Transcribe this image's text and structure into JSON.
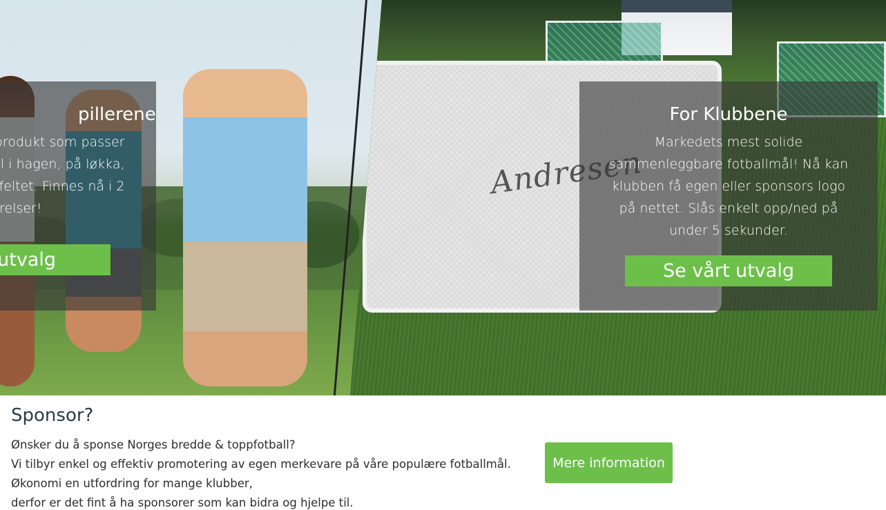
{
  "hero": {
    "left_panel": {
      "heading": "pillerene",
      "text": "produkt som passer pill i hagen, på løkka, feltet. Finnes nå i 2 relser!",
      "lines": [
        "produkt som passer",
        "pill i hagen, på løkka,",
        "feltet. Finnes nå i 2",
        "relser!"
      ],
      "button_label": "t utvalg"
    },
    "right_panel": {
      "heading": "For Klubbene",
      "text": "Markedets mest solide sammenleggbare fotballmål! Nå kan klubben få egen eller sponsors logo på nettet. Slås enkelt opp/ned på under 5 sekunder.",
      "button_label": "Se vårt utvalg"
    },
    "goal_logo_text": "Andresen"
  },
  "sponsor": {
    "title": "Sponsor?",
    "lines": [
      "Ønsker du å sponse Norges bredde & toppfotball?",
      "Vi tilbyr enkel og effektiv promotering av egen merkevare på våre populære fotballmål.",
      "Økonomi en utfordring for mange klubber,",
      "derfor er det fint å ha sponsorer som kan bidra og hjelpe til."
    ],
    "button_label": "Mere information"
  },
  "colors": {
    "accent_green": "#6cc04a",
    "overlay": "rgba(55,55,55,0.62)"
  }
}
